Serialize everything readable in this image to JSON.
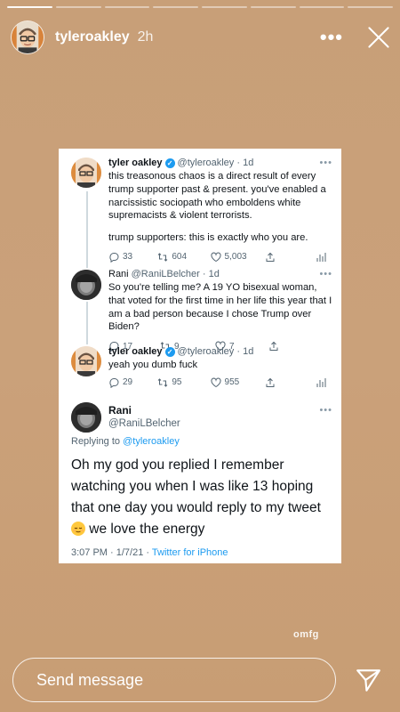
{
  "story": {
    "progress_segments": 8,
    "progress_done": 1,
    "username": "tyleroakley",
    "time": "2h",
    "more_icon": "more-horizontal-icon",
    "close_icon": "close-icon",
    "sticker_text": "omfg"
  },
  "tweets": [
    {
      "name": "tyler oakley",
      "handle": "@tyleroakley",
      "age": "· 1d",
      "verified": true,
      "text": "this treasonous chaos is a direct result of every trump supporter past & present. you've enabled a narcissistic sociopath who emboldens white supremacists & violent terrorists.",
      "text2": "trump supporters: this is exactly who you are.",
      "replies": "33",
      "retweets": "604",
      "likes": "5,003"
    },
    {
      "name": "Rani",
      "handle": "@RaniLBelcher",
      "age": "· 1d",
      "verified": false,
      "text": "So you're telling me? A 19 YO bisexual woman, that voted for the first time in her life this year that I am a bad person because I chose Trump over Biden?",
      "replies": "17",
      "retweets": "9",
      "likes": "7"
    },
    {
      "name": "tyler oakley",
      "handle": "@tyleroakley",
      "age": "· 1d",
      "verified": true,
      "text": "yeah you dumb fuck",
      "replies": "29",
      "retweets": "95",
      "likes": "955"
    }
  ],
  "main_tweet": {
    "name": "Rani",
    "handle": "@RaniLBelcher",
    "replying_label": "Replying to",
    "replying_handle": "@tyleroakley",
    "text": "Oh my god  you replied I remember watching you when I was like 13 hoping that one day you would reply to my tweet",
    "text_after_emoji": " we love the energy",
    "time": "3:07 PM · 1/7/21 · ",
    "source": "Twitter for iPhone"
  },
  "bottom": {
    "send_placeholder": "Send message",
    "send_icon": "send-paper-plane-icon"
  },
  "colors": {
    "background": "#c89f78",
    "twitter_blue": "#1d9bf0",
    "text_secondary": "#536471"
  }
}
